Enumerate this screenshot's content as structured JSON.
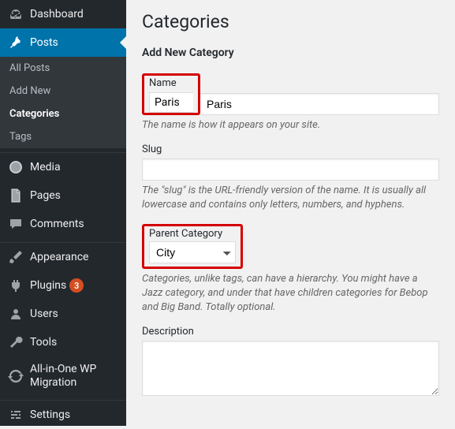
{
  "sidebar": {
    "dashboard": "Dashboard",
    "posts": "Posts",
    "posts_sub": {
      "all": "All Posts",
      "addnew": "Add New",
      "categories": "Categories",
      "tags": "Tags"
    },
    "media": "Media",
    "pages": "Pages",
    "comments": "Comments",
    "appearance": "Appearance",
    "plugins": "Plugins",
    "plugins_badge": "3",
    "users": "Users",
    "tools": "Tools",
    "aio": "All-in-One WP Migration",
    "settings": "Settings"
  },
  "page": {
    "title": "Categories",
    "section": "Add New Category",
    "name_label": "Name",
    "name_value": "Paris",
    "name_desc": "The name is how it appears on your site.",
    "slug_label": "Slug",
    "slug_value": "",
    "slug_desc": "The \"slug\" is the URL-friendly version of the name. It is usually all lowercase and contains only letters, numbers, and hyphens.",
    "parent_label": "Parent Category",
    "parent_value": "City",
    "parent_desc": "Categories, unlike tags, can have a hierarchy. You might have a Jazz category, and under that have children categories for Bebop and Big Band. Totally optional.",
    "desc_label": "Description",
    "desc_value": ""
  }
}
